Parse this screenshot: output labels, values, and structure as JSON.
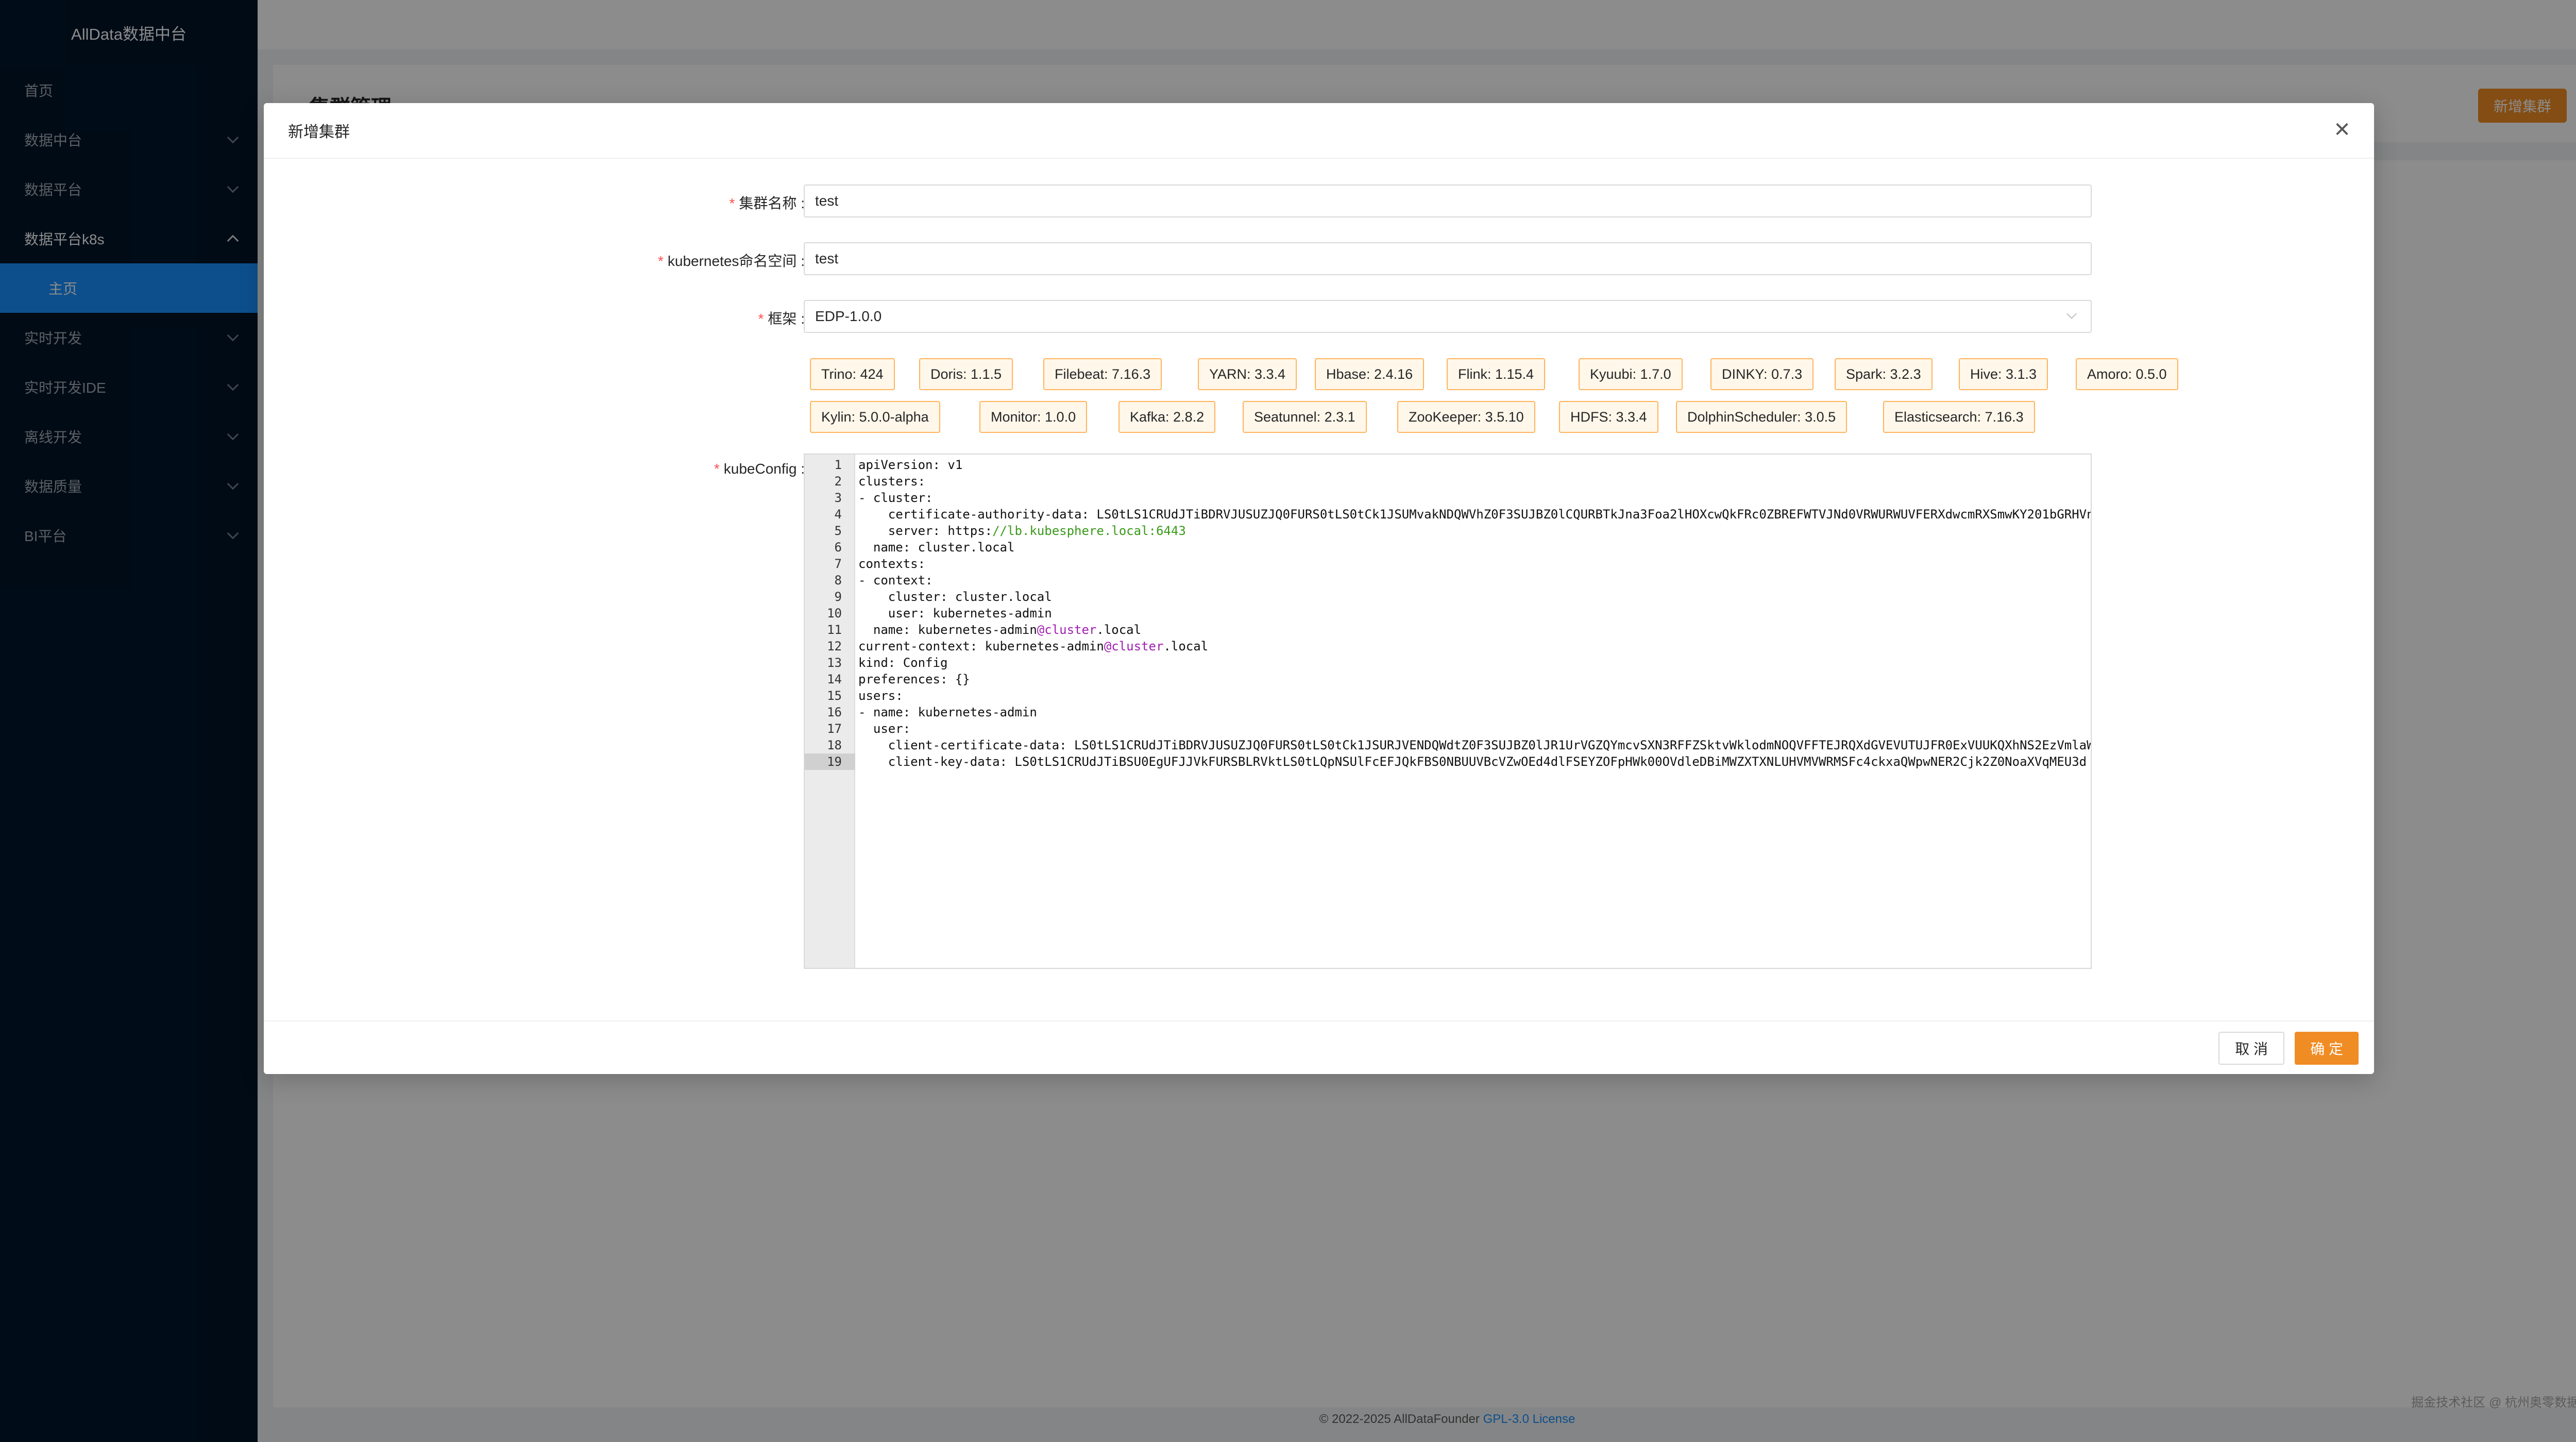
{
  "app": {
    "title": "AllData数据中台"
  },
  "sidebar": {
    "items": [
      {
        "label": "首页",
        "has_arrow": false
      },
      {
        "label": "数据中台",
        "has_arrow": true
      },
      {
        "label": "数据平台",
        "has_arrow": true
      },
      {
        "label": "数据平台k8s",
        "has_arrow": true,
        "open": true
      },
      {
        "label": "主页",
        "sub": true,
        "active": true
      },
      {
        "label": "实时开发",
        "has_arrow": true
      },
      {
        "label": "实时开发IDE",
        "has_arrow": true
      },
      {
        "label": "离线开发",
        "has_arrow": true
      },
      {
        "label": "数据质量",
        "has_arrow": true
      },
      {
        "label": "BI平台",
        "has_arrow": true
      }
    ]
  },
  "page": {
    "title": "集群管理",
    "add_button": "新增集群"
  },
  "modal": {
    "title": "新增集群",
    "close_icon": "close-icon",
    "fields": {
      "cluster_name": {
        "label": "集群名称",
        "value": "test"
      },
      "namespace": {
        "label": "kubernetes命名空间",
        "value": "test"
      },
      "framework": {
        "label": "框架",
        "value": "EDP-1.0.0"
      },
      "kubeconfig": {
        "label": "kubeConfig"
      }
    },
    "components": [
      "Trino: 424",
      "Doris: 1.1.5",
      "Filebeat: 7.16.3",
      "YARN: 3.3.4",
      "Hbase: 2.4.16",
      "Flink: 1.15.4",
      "Kyuubi: 1.7.0",
      "DINKY: 0.7.3",
      "Spark: 3.2.3",
      "Hive: 3.1.3",
      "Amoro: 0.5.0",
      "Kylin: 5.0.0-alpha",
      "Monitor: 1.0.0",
      "Kafka: 2.8.2",
      "Seatunnel: 2.3.1",
      "ZooKeeper: 3.5.10",
      "HDFS: 3.3.4",
      "DolphinScheduler: 3.0.5",
      "Elasticsearch: 7.16.3"
    ],
    "code_lines": [
      "apiVersion: v1",
      "clusters:",
      "- cluster:",
      "    certificate-authority-data: LS0tLS1CRUdJTiBDRVJUSUZJQ0FURS0tLS0tCk1JSUMvakNDQWVhZ0F3SUJBZ0lCQURBTkJna3Foa2lHOXcwQkFRc0ZBREFWTVJNd0VRWURWUVFERXdwcmRXSmwKY201bGRHVn",
      "    server: https://lb.kubesphere.local:6443",
      "  name: cluster.local",
      "contexts:",
      "- context:",
      "    cluster: cluster.local",
      "    user: kubernetes-admin",
      "  name: kubernetes-admin@cluster.local",
      "current-context: kubernetes-admin@cluster.local",
      "kind: Config",
      "preferences: {}",
      "users:",
      "- name: kubernetes-admin",
      "  user:",
      "    client-certificate-data: LS0tLS1CRUdJTiBDRVJUSUZJQ0FURS0tLS0tCk1JSURJVENDQWdtZ0F3SUJBZ0lJR1UrVGZQYmcvSXN3RFFZSktvWklodmNOQVFFTEJRQXdGVEVUTUJFR0ExVUUKQXhNS2EzVmlaW",
      "    client-key-data: LS0tLS1CRUdJTiBSU0EgUFJJVkFURSBLRVktLS0tLQpNSUlFcEFJQkFBS0NBUUVBcVZwOEd4dlFSEYZOFpHWk00OVdleDBiMWZXTXNLUHVMVWRMSFc4ckxaQWpwNER2Cjk2Z0NoaXVqMEU3d"
    ],
    "cancel_button": "取 消",
    "ok_button": "确 定"
  },
  "footer": {
    "copyright": "© 2022-2025 AllDataFounder ",
    "license_link": "GPL-3.0 License",
    "watermark": "掘金技术社区 @ 杭州奥零数据科技"
  },
  "colors": {
    "accent": "#f08c24",
    "sidebar_bg": "#001529",
    "active_menu": "#1890ff",
    "tag_border": "#ffb45c",
    "tag_bg": "#fff7ea"
  }
}
